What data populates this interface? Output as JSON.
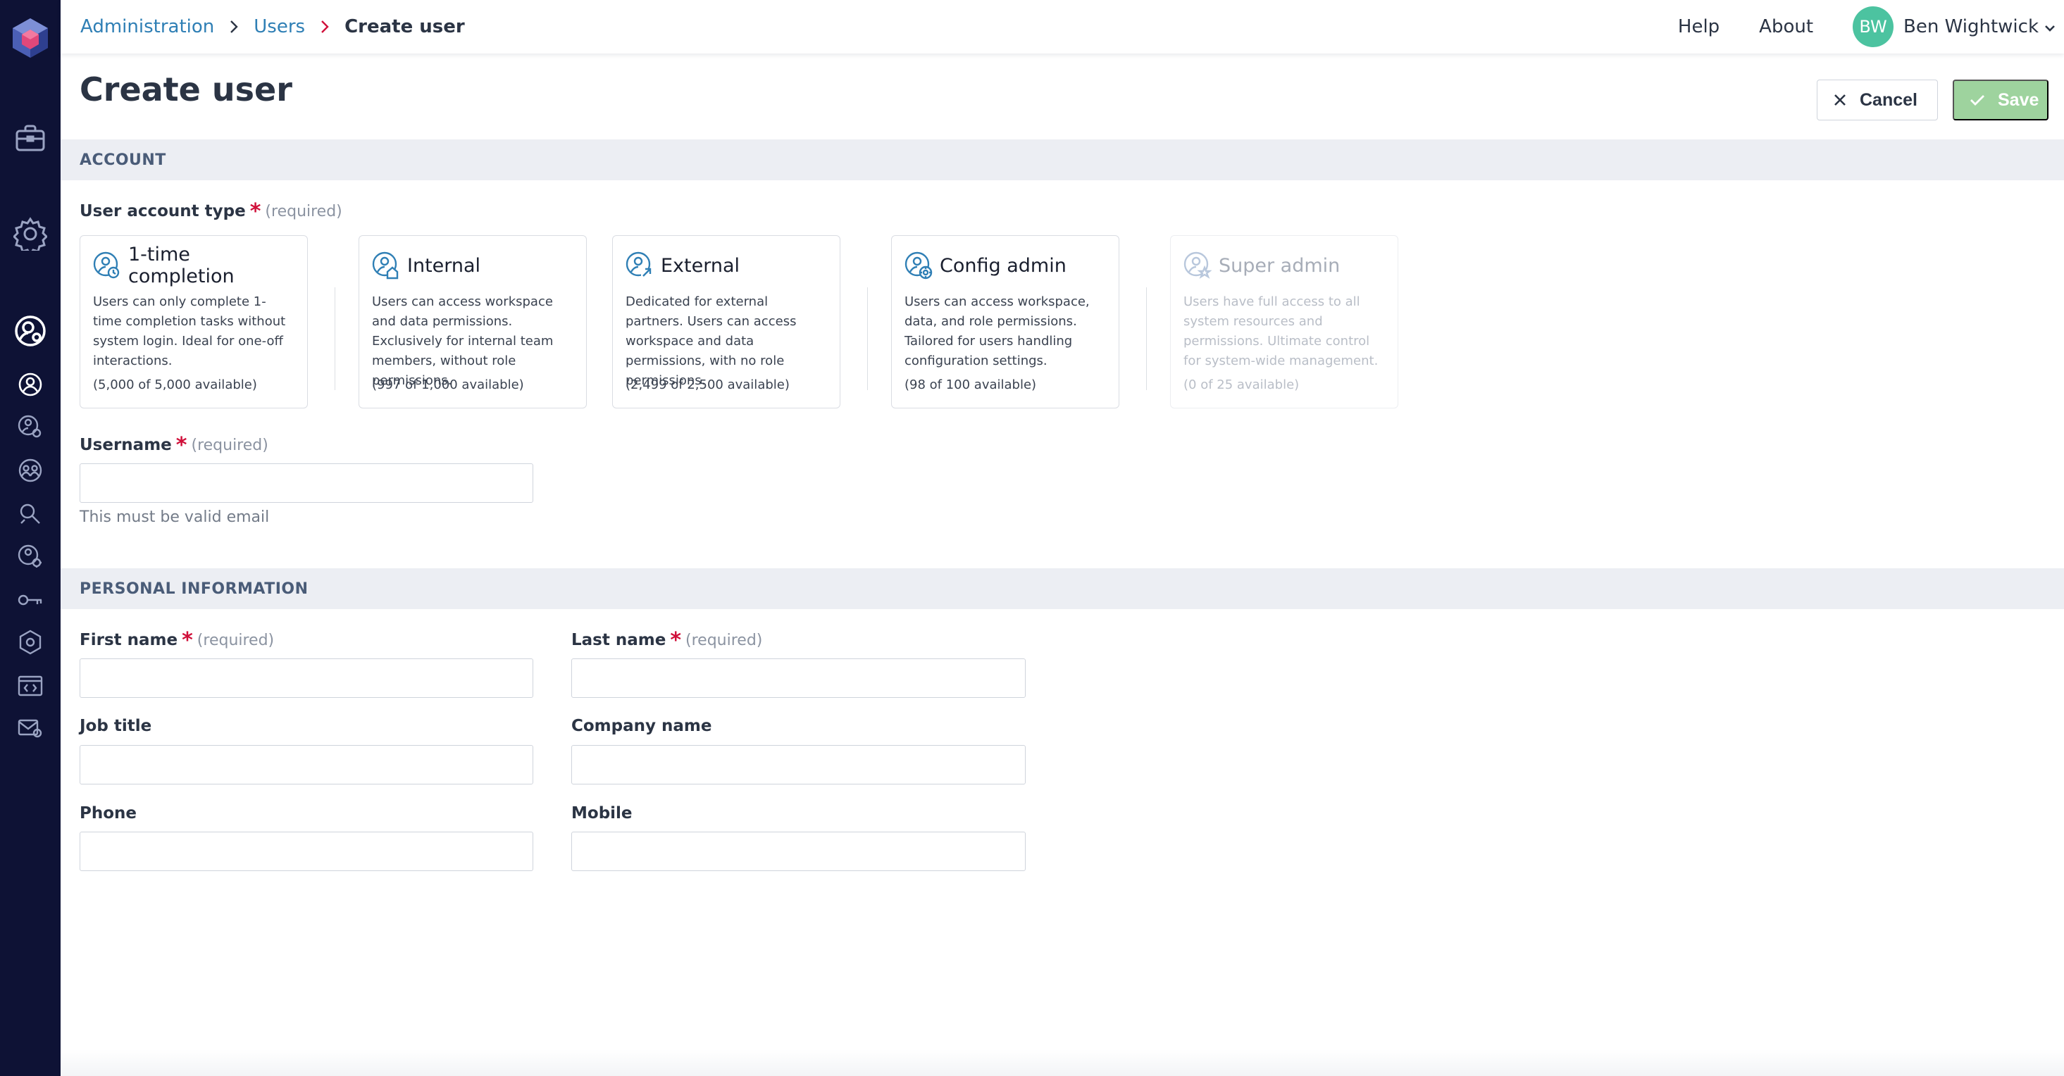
{
  "breadcrumb": {
    "items": [
      "Administration",
      "Users"
    ],
    "current": "Create user"
  },
  "header": {
    "help": "Help",
    "about": "About",
    "user_initials": "BW",
    "user_name": "Ben Wightwick"
  },
  "page": {
    "title": "Create user",
    "cancel_label": "Cancel",
    "save_label": "Save"
  },
  "sections": {
    "account": "ACCOUNT",
    "personal": "PERSONAL INFORMATION"
  },
  "required_text": "(required)",
  "account_type": {
    "label": "User account type",
    "cards": [
      {
        "title": "1-time completion",
        "description": "Users can only complete 1-time completion tasks without system login. Ideal for one-off interactions.",
        "availability": "(5,000 of 5,000 available)",
        "icon": "user-clock-icon"
      },
      {
        "title": "Internal",
        "description": "Users can access workspace and data permissions. Exclusively for internal team members, without role permissions.",
        "availability": "(997 of 1,000 available)",
        "icon": "user-home-icon"
      },
      {
        "title": "External",
        "description": "Dedicated for external partners. Users can access workspace and data permissions, with no role permissions.",
        "availability": "(2,499 of 2,500 available)",
        "icon": "user-external-icon"
      },
      {
        "title": "Config admin",
        "description": "Users can access workspace, data, and role permissions. Tailored for users handling configuration settings.",
        "availability": "(98 of 100 available)",
        "icon": "user-gear-icon"
      },
      {
        "title": "Super admin",
        "description": "Users have full access to all system resources and permissions. Ultimate control for system-wide management.",
        "availability": "(0 of 25 available)",
        "icon": "user-star-icon"
      }
    ]
  },
  "username": {
    "label": "Username",
    "value": "",
    "hint": "This must be valid email"
  },
  "personal": {
    "first_name": {
      "label": "First name",
      "value": ""
    },
    "last_name": {
      "label": "Last name",
      "value": ""
    },
    "job_title": {
      "label": "Job title",
      "value": ""
    },
    "company_name": {
      "label": "Company name",
      "value": ""
    },
    "phone": {
      "label": "Phone",
      "value": ""
    },
    "mobile": {
      "label": "Mobile",
      "value": ""
    }
  },
  "sidebar": {
    "icons": [
      "app-logo-icon",
      "briefcase-icon",
      "settings-icon",
      "user-admin-icon",
      "user-icon",
      "user-permission-icon",
      "groups-icon",
      "search-permission-icon",
      "user-settings-icon",
      "key-icon",
      "security-shield-icon",
      "code-window-icon",
      "mail-settings-icon"
    ]
  },
  "colors": {
    "sidebar": "#0e1235",
    "accent_link": "#2f7fb5",
    "required": "#d0103a",
    "avatar": "#4cc3a0",
    "save_button": "#9ed39e",
    "section_bar": "#eceef3"
  }
}
